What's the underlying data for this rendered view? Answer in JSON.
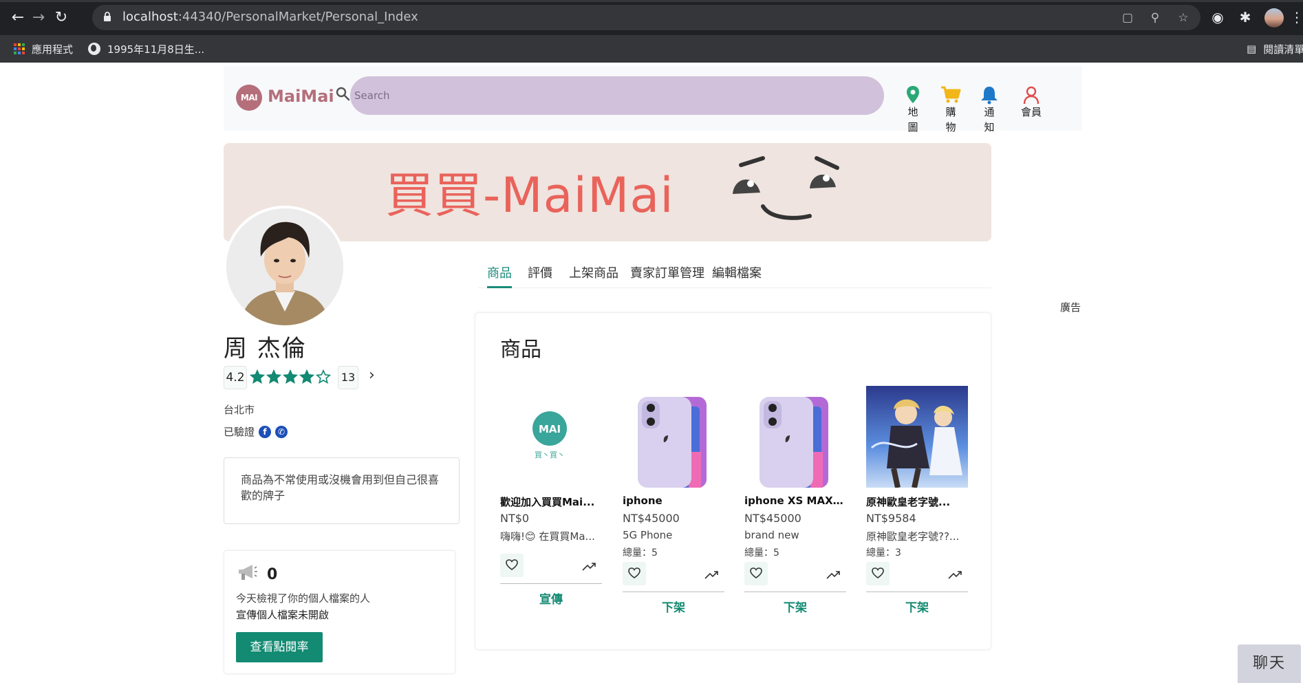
{
  "browser": {
    "url_host": "localhost",
    "url_path": ":44340/PersonalMarket/Personal_Index",
    "bookmarks": [
      {
        "label": "應用程式",
        "icon": "apps-grid-icon"
      },
      {
        "label": "1995年11月8日生...",
        "icon": "globe-icon"
      }
    ],
    "reading_list": "閱讀清單"
  },
  "header": {
    "logo_mark": "MAI",
    "logo_text": "MaiMai",
    "search_placeholder": "Search",
    "nav": [
      {
        "label": "地圖",
        "icon": "map-pin-icon",
        "color": "#2aa876"
      },
      {
        "label": "購物",
        "icon": "cart-icon",
        "color": "#f2b619"
      },
      {
        "label": "通知",
        "icon": "bell-icon",
        "color": "#1e78c8"
      },
      {
        "label": "會員",
        "icon": "user-icon",
        "color": "#e24b4b"
      }
    ]
  },
  "banner": {
    "title": "買買-MaiMai",
    "bg_color": "#efe4df",
    "title_color": "#e9635b"
  },
  "profile": {
    "name": "周 杰倫",
    "rating": "4.2",
    "stars_filled": 4,
    "stars_total": 5,
    "review_count": "13",
    "city": "台北市",
    "verified_label": "已驗證",
    "verified_icons": [
      "facebook-icon",
      "phone-icon"
    ],
    "description": "商品為不常使用或沒機會用到但自己很喜歡的牌子"
  },
  "tabs": [
    {
      "label": "商品",
      "active": true
    },
    {
      "label": "評價",
      "active": false
    },
    {
      "label": "上架商品",
      "active": false
    },
    {
      "label": "賣家訂單管理",
      "active": false
    },
    {
      "label": "編輯檔案",
      "active": false
    }
  ],
  "ad_label": "廣告",
  "stats": {
    "count": "0",
    "description": "今天檢視了你的個人檔案的人",
    "status": "宣傳個人檔案未開啟",
    "button": "查看點閱率"
  },
  "products": {
    "title": "商品",
    "accent_color": "#138a72",
    "items": [
      {
        "name": "歡迎加入買買Mai...",
        "price": "NT$0",
        "subtitle": "嗨嗨!😊 在買買Ma...",
        "quantity": "",
        "action": "宣傳",
        "image": "maimai-logo",
        "logo_mark": "MAI",
        "logo_sub": "買丶買丶"
      },
      {
        "name": "iphone",
        "price": "NT$45000",
        "subtitle": "5G Phone",
        "quantity": "總量：5",
        "action": "下架",
        "image": "iphone-purple"
      },
      {
        "name": "iphone XS MAX 2...",
        "price": "NT$45000",
        "subtitle": "brand new",
        "quantity": "總量：5",
        "action": "下架",
        "image": "iphone-purple"
      },
      {
        "name": "原神歐皇老字號...",
        "price": "NT$9584",
        "subtitle": "原神歐皇老字號??...",
        "quantity": "總量：3",
        "action": "下架",
        "image": "anime-art"
      }
    ]
  },
  "chat_label": "聊天"
}
